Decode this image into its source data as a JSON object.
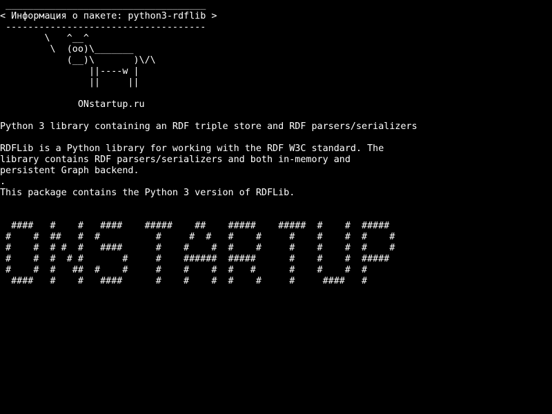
{
  "colors": {
    "background": "#000000",
    "foreground": "#ffffff"
  },
  "banner": {
    "top_rule": " ____________________________________",
    "title": "< Информация о пакете: python3-rdflib >",
    "bottom_rule": " ------------------------------------"
  },
  "cow": [
    "        \\   ^__^",
    "         \\  (oo)\\_______",
    "            (__)\\       )\\/\\",
    "                ||----w |",
    "                ||     ||"
  ],
  "site": "              ONstartup.ru",
  "summary": "Python 3 library containing an RDF triple store and RDF parsers/serializers",
  "description": [
    "RDFLib is a Python library for working with the RDF W3C standard. The",
    "library contains RDF parsers/serializers and both in-memory and",
    "persistent Graph backend.",
    ".",
    "This package contains the Python 3 version of RDFLib."
  ],
  "big_text": [
    "  ####   #    #   ####    #####    ##    #####    #####  #    #  #####",
    " #    #  ##   #  #          #     #  #   #    #     #    #    #  #    #",
    " #    #  # #  #   ####      #    #    #  #    #     #    #    #  #    #",
    " #    #  #  # #       #     #    ######  #####      #    #    #  #####",
    " #    #  #   ##  #    #     #    #    #  #   #      #    #    #  #",
    "  ####   #    #   ####      #    #    #  #    #     #     ####   #"
  ]
}
